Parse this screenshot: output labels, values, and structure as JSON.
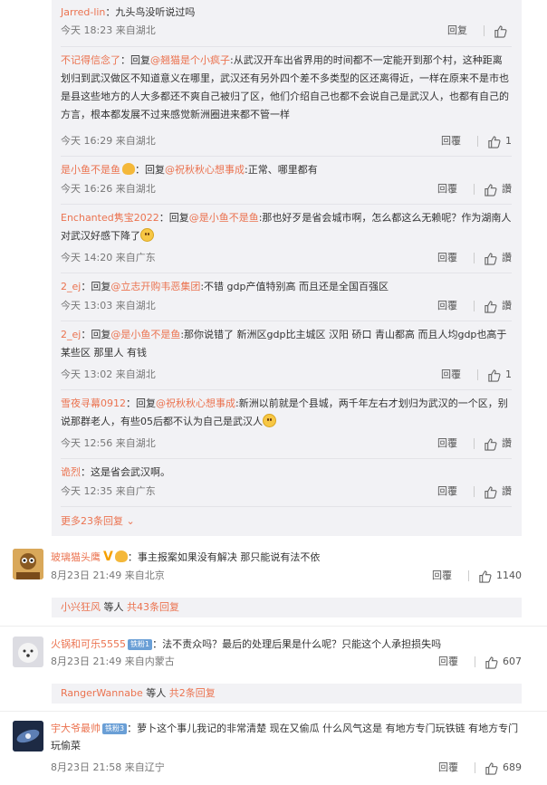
{
  "sub_comments": [
    {
      "user": "Jarred-lin",
      "body": "：九头鸟没听说过吗",
      "time": "今天 18:23 来自湖北",
      "reply": "回复",
      "likes": ""
    },
    {
      "user": "不记得信念了",
      "prefix": "：回复",
      "mention": "@翘猫是个小疯子",
      "body": ":从武汉开车出省界用的时间都不一定能开到那个村，这种距离划归到武汉做区不知道意义在哪里，武汉还有另外四个差不多类型的区还离得近，一样在原来不是市也是县这些地方的人大多都还不爽自己被归了区，他们介绍自己也都不会说自己是武汉人，也都有自己的方言，根本都发展不过来感觉新洲圈进来都不管一样",
      "time": "今天 16:29 来自湖北",
      "reply": "回覆",
      "likes": "1"
    },
    {
      "user": "是小鱼不是鱼",
      "prefix": "：回复",
      "mention": "@祝秋秋心想事成",
      "body": ":正常、哪里都有",
      "time": "今天 16:26 来自湖北",
      "reply": "回覆",
      "likes": "讚"
    },
    {
      "user": "Enchanted隽宝2022",
      "prefix": "：回复",
      "mention": "@是小鱼不是鱼",
      "body": ":那也好歹是省会城市啊，怎么都这么无赖呢？作为湖南人对武汉好感下降了",
      "time": "今天 14:20 来自广东",
      "reply": "回覆",
      "likes": "讚"
    },
    {
      "user": "2_ej",
      "prefix": "：回复",
      "mention": "@立志开购韦恶集团",
      "body": ":不错 gdp产值特别高 而且还是全国百强区",
      "time": "今天 13:03 来自湖北",
      "reply": "回覆",
      "likes": "讚"
    },
    {
      "user": "2_ej",
      "prefix": "：回复",
      "mention": "@是小鱼不是鱼",
      "body": ":那你说错了 新洲区gdp比主城区 汉阳 硚口 青山都高 而且人均gdp也高于某些区 那里人 有钱",
      "time": "今天 13:02 来自湖北",
      "reply": "回覆",
      "likes": "1"
    },
    {
      "user": "雪夜寻幕0912",
      "prefix": "：回复",
      "mention": "@祝秋秋心想事成",
      "body": ":新洲以前就是个县城，两千年左右才划归为武汉的一个区，别说那群老人，有些05后都不认为自己是武汉人",
      "time": "今天 12:56 来自湖北",
      "reply": "回覆",
      "likes": "讚"
    },
    {
      "user": "诡烈",
      "body": "：这是省会武汉啊。",
      "time": "今天 12:35 来自广东",
      "reply": "回覆",
      "likes": "讚"
    }
  ],
  "more_replies": "更多23条回复 ⌄",
  "top_comments": [
    {
      "user": "玻璃猫头鹰",
      "badge": "V",
      "body": "：事主报案如果没有解决 那只能说有法不依",
      "time": "8月23日 21:49 来自北京",
      "reply": "回覆",
      "likes": "1140",
      "thread": {
        "user": "小兴狂风",
        "text": " 等人 ",
        "count": "共43条回复"
      }
    },
    {
      "user": "火锅和可乐5555",
      "iron": "铁粉1",
      "body": "：法不责众吗？最后的处理后果是什么呢？只能这个人承担损失吗",
      "time": "8月23日 21:49 来自内蒙古",
      "reply": "回覆",
      "likes": "607",
      "thread": {
        "user": "RangerWannabe",
        "text": " 等人 ",
        "count": "共2条回复"
      }
    },
    {
      "user": "宇大爷最帅",
      "iron": "铁粉3",
      "body": "：萝卜这个事儿我记的非常清楚 现在又偷瓜 什么风气这是 有地方专门玩铁链 有地方专门玩偷菜",
      "time": "8月23日 21:58 来自辽宁",
      "reply": "回覆",
      "likes": "689"
    }
  ],
  "icons": {
    "like": "thumbs-up-icon",
    "avatar_colors": [
      "#c98f3d",
      "#e8e8ec",
      "#2f4b78"
    ]
  }
}
